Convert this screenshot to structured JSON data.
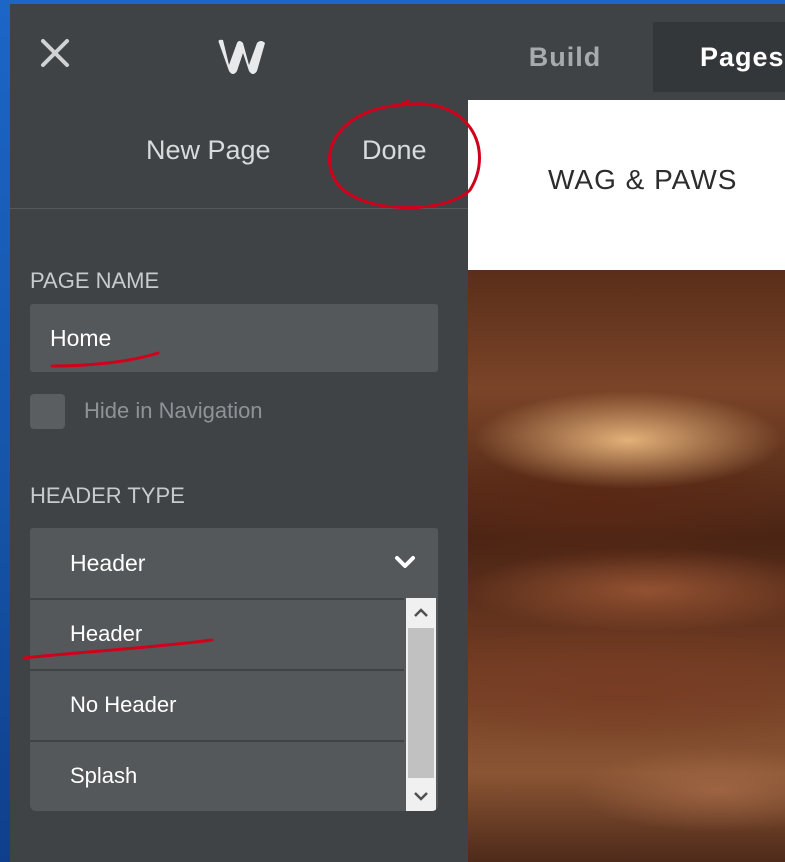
{
  "topbar": {
    "close_icon": "close-icon",
    "logo_icon": "weebly-logo-icon",
    "tabs": [
      {
        "label": "Build",
        "active": false
      },
      {
        "label": "Pages",
        "active": true
      }
    ]
  },
  "sidebar": {
    "new_page_label": "New Page",
    "done_label": "Done",
    "page_name_label": "PAGE NAME",
    "page_name_value": "Home",
    "hide_nav_label": "Hide in Navigation",
    "hide_nav_checked": false,
    "header_type_label": "HEADER TYPE",
    "header_type_selected": "Header",
    "header_type_options": [
      "Header",
      "No Header",
      "Splash"
    ]
  },
  "preview": {
    "site_title": "WAG & PAWS"
  },
  "colors": {
    "panel": "#3f4346",
    "field": "#54585b",
    "annotation": "#d0021b",
    "desktop": "#1a5fb4"
  }
}
